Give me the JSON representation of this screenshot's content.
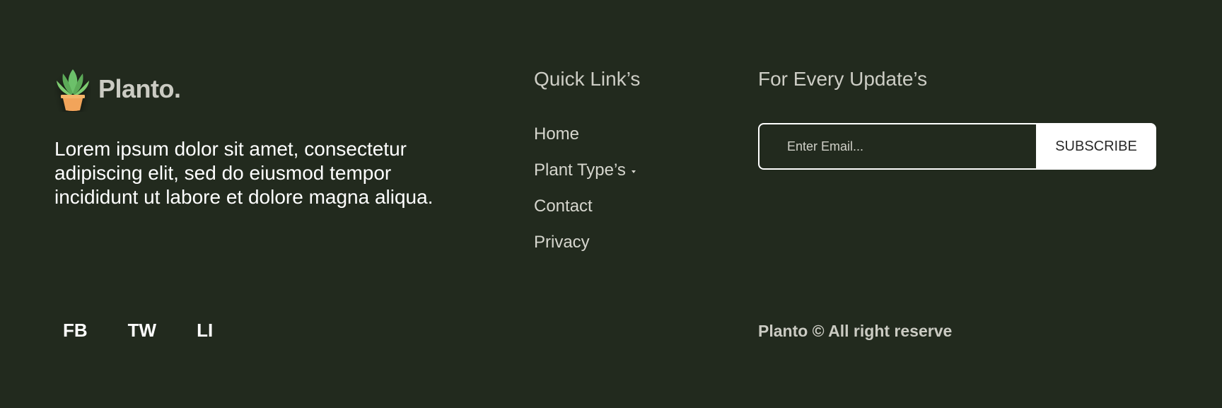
{
  "brand": {
    "name": "Planto.",
    "logo_icon": "potted-plant-icon"
  },
  "about": {
    "text": "Lorem ipsum dolor sit amet, consectetur adipiscing elit, sed do eiusmod tempor incididunt ut labore et dolore magna aliqua."
  },
  "quick_links": {
    "title": "Quick Link’s",
    "items": [
      {
        "label": "Home"
      },
      {
        "label": "Plant Type’s",
        "icon": "caret-down-icon"
      },
      {
        "label": "Contact"
      },
      {
        "label": "Privacy"
      }
    ]
  },
  "updates": {
    "title": "For Every Update’s",
    "email_placeholder": "Enter Email...",
    "email_value": "",
    "subscribe_label": "SUBSCRIBE"
  },
  "social": {
    "items": [
      {
        "label": "FB"
      },
      {
        "label": "TW"
      },
      {
        "label": "LI"
      }
    ]
  },
  "copyright": {
    "text": "Planto © All right reserve"
  },
  "colors": {
    "background": "#222A1E",
    "text_primary": "#FFFFFF",
    "text_muted": "#CBCBC3",
    "button_bg": "#FFFFFF",
    "button_text": "#2A2A2A",
    "leaf_green": "#6BBF5E",
    "pot_orange": "#F2A45A"
  }
}
